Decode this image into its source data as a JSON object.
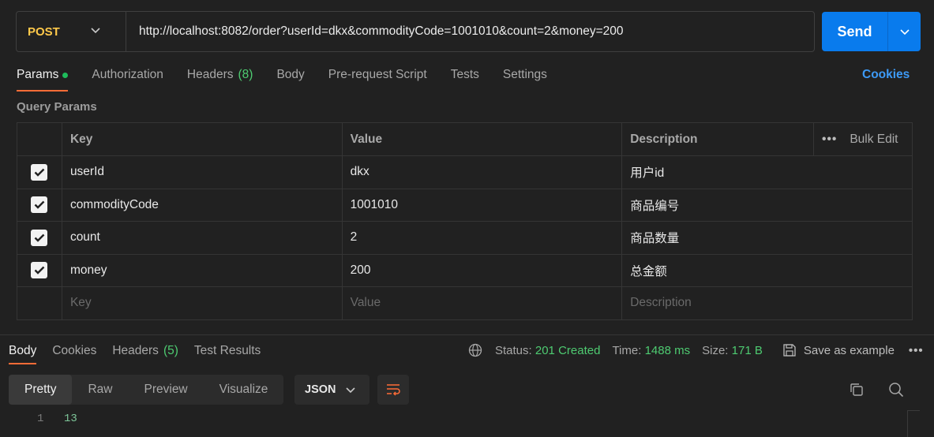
{
  "request": {
    "method": "POST",
    "url": "http://localhost:8082/order?userId=dkx&commodityCode=1001010&count=2&money=200",
    "send_label": "Send"
  },
  "request_tabs": {
    "params": "Params",
    "authorization": "Authorization",
    "headers": "Headers",
    "headers_count": "(8)",
    "body": "Body",
    "prerequest": "Pre-request Script",
    "tests": "Tests",
    "settings": "Settings",
    "cookies": "Cookies"
  },
  "query_params": {
    "title": "Query Params",
    "columns": {
      "key": "Key",
      "value": "Value",
      "description": "Description",
      "bulk_edit": "Bulk Edit",
      "more": "•••"
    },
    "rows": [
      {
        "key": "userId",
        "value": "dkx",
        "description": "用户id",
        "checked": true
      },
      {
        "key": "commodityCode",
        "value": "1001010",
        "description": "商品编号",
        "checked": true
      },
      {
        "key": "count",
        "value": "2",
        "description": "商品数量",
        "checked": true
      },
      {
        "key": "money",
        "value": "200",
        "description": "总金额",
        "checked": true
      }
    ],
    "placeholders": {
      "key": "Key",
      "value": "Value",
      "description": "Description"
    }
  },
  "response_tabs": {
    "body": "Body",
    "cookies": "Cookies",
    "headers": "Headers",
    "headers_count": "(5)",
    "test_results": "Test Results"
  },
  "response_meta": {
    "status_label": "Status:",
    "status_value": "201 Created",
    "time_label": "Time:",
    "time_value": "1488 ms",
    "size_label": "Size:",
    "size_value": "171 B",
    "save_example": "Save as example",
    "more": "•••"
  },
  "format": {
    "pretty": "Pretty",
    "raw": "Raw",
    "preview": "Preview",
    "visualize": "Visualize",
    "language": "JSON"
  },
  "response_body": {
    "line_number": "1",
    "content": "13"
  },
  "colors": {
    "background": "#212121",
    "accent_orange": "#ff6c37",
    "send_blue": "#097bed",
    "method_yellow": "#ffc94a",
    "status_green": "#4ecb71",
    "link_blue": "#3d9af6"
  }
}
